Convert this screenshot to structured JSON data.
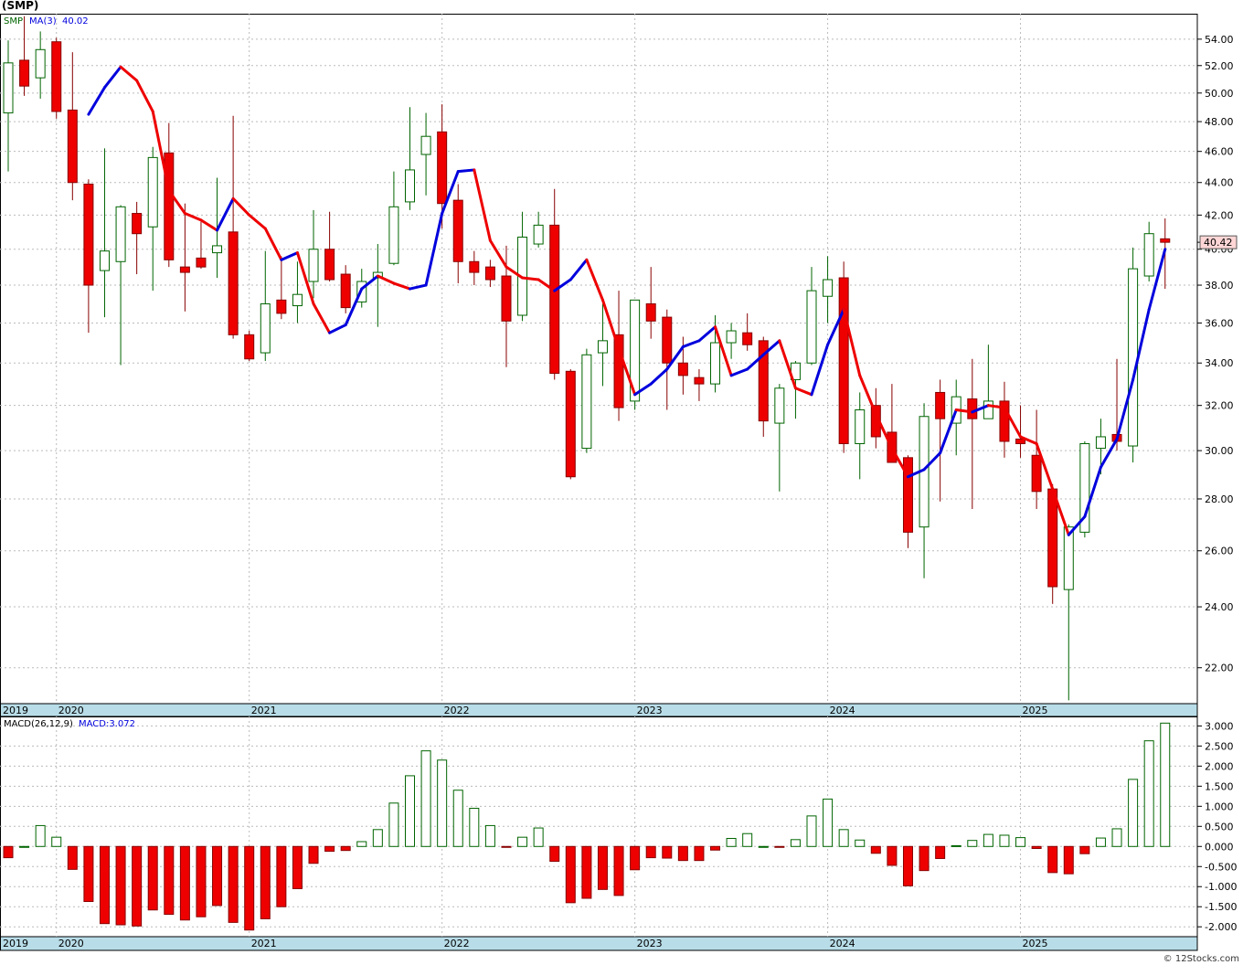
{
  "title": "(SMP)",
  "watermark": "© 12Stocks.com",
  "price_panel": {
    "symbol_label": "SMP",
    "ma_label": "MA(3)",
    "ma_value": "40.02",
    "last_price_label": "40.42",
    "y_ticks": [
      "54.00",
      "52.00",
      "50.00",
      "48.00",
      "46.00",
      "44.00",
      "42.00",
      "40.00",
      "38.00",
      "36.00",
      "34.00",
      "32.00",
      "30.00",
      "28.00",
      "26.00",
      "24.00",
      "22.00"
    ],
    "x_ticks": [
      "2019",
      "2020",
      "2021",
      "2022",
      "2023",
      "2024",
      "2025"
    ]
  },
  "macd_panel": {
    "label": "MACD(26,12,9)",
    "value_label": "MACD:3.072",
    "y_ticks": [
      "3.000",
      "2.500",
      "2.000",
      "1.500",
      "1.000",
      "0.500",
      "0.000",
      "-0.500",
      "-1.000",
      "-1.500",
      "-2.000"
    ],
    "x_ticks": [
      "2019",
      "2020",
      "2021",
      "2022",
      "2023",
      "2024",
      "2025"
    ]
  },
  "colors": {
    "up_fill": "#ffffff",
    "up_stroke": "#006400",
    "down_fill": "#ee0000",
    "down_stroke": "#880000",
    "ma_down": "#ee0000",
    "ma_up": "#0000dd",
    "axis_band": "#b8dde8",
    "grid": "#bbbbbb"
  },
  "chart_data": [
    {
      "type": "candlestick",
      "title": "(SMP)",
      "series_name": "SMP",
      "overlay": {
        "name": "MA(3)",
        "last": 40.02
      },
      "scale": "log",
      "ylim": [
        20.9,
        56.0
      ],
      "x_axis_labels": [
        "2019",
        "2020",
        "2021",
        "2022",
        "2023",
        "2024",
        "2025"
      ],
      "candles": [
        {
          "o": 48.6,
          "h": 53.9,
          "l": 44.7,
          "c": 52.2
        },
        {
          "o": 52.4,
          "h": 55.8,
          "l": 49.8,
          "c": 50.5
        },
        {
          "o": 51.1,
          "h": 54.6,
          "l": 49.6,
          "c": 53.2
        },
        {
          "o": 53.8,
          "h": 54.1,
          "l": 48.2,
          "c": 48.7
        },
        {
          "o": 48.8,
          "h": 53.0,
          "l": 42.9,
          "c": 44.0
        },
        {
          "o": 43.9,
          "h": 44.2,
          "l": 35.5,
          "c": 38.0
        },
        {
          "o": 38.8,
          "h": 46.2,
          "l": 36.3,
          "c": 39.9
        },
        {
          "o": 39.3,
          "h": 42.6,
          "l": 33.9,
          "c": 42.5
        },
        {
          "o": 42.1,
          "h": 42.8,
          "l": 38.6,
          "c": 40.9
        },
        {
          "o": 41.3,
          "h": 46.3,
          "l": 37.7,
          "c": 45.6
        },
        {
          "o": 45.9,
          "h": 47.9,
          "l": 39.0,
          "c": 39.4
        },
        {
          "o": 39.0,
          "h": 42.7,
          "l": 36.6,
          "c": 38.7
        },
        {
          "o": 39.5,
          "h": 41.6,
          "l": 38.9,
          "c": 39.0
        },
        {
          "o": 39.8,
          "h": 44.3,
          "l": 38.4,
          "c": 40.2
        },
        {
          "o": 41.0,
          "h": 48.4,
          "l": 35.2,
          "c": 35.4
        },
        {
          "o": 35.4,
          "h": 35.6,
          "l": 34.1,
          "c": 34.2
        },
        {
          "o": 34.5,
          "h": 39.9,
          "l": 34.1,
          "c": 37.0
        },
        {
          "o": 37.2,
          "h": 39.6,
          "l": 36.2,
          "c": 36.5
        },
        {
          "o": 36.9,
          "h": 39.3,
          "l": 36.0,
          "c": 37.5
        },
        {
          "o": 38.2,
          "h": 42.3,
          "l": 37.3,
          "c": 40.0
        },
        {
          "o": 40.0,
          "h": 42.2,
          "l": 38.2,
          "c": 38.3
        },
        {
          "o": 38.6,
          "h": 39.1,
          "l": 36.5,
          "c": 36.8
        },
        {
          "o": 37.1,
          "h": 38.9,
          "l": 36.8,
          "c": 38.2
        },
        {
          "o": 38.4,
          "h": 40.3,
          "l": 35.8,
          "c": 38.7
        },
        {
          "o": 39.2,
          "h": 44.7,
          "l": 39.1,
          "c": 42.5
        },
        {
          "o": 42.8,
          "h": 49.0,
          "l": 42.3,
          "c": 44.8
        },
        {
          "o": 45.8,
          "h": 48.6,
          "l": 43.2,
          "c": 47.0
        },
        {
          "o": 47.3,
          "h": 49.2,
          "l": 41.2,
          "c": 42.7
        },
        {
          "o": 42.9,
          "h": 43.9,
          "l": 38.1,
          "c": 39.3
        },
        {
          "o": 39.3,
          "h": 39.9,
          "l": 38.0,
          "c": 38.7
        },
        {
          "o": 39.0,
          "h": 39.4,
          "l": 37.9,
          "c": 38.3
        },
        {
          "o": 38.5,
          "h": 40.2,
          "l": 33.8,
          "c": 36.1
        },
        {
          "o": 36.4,
          "h": 42.2,
          "l": 36.1,
          "c": 40.7
        },
        {
          "o": 40.3,
          "h": 42.2,
          "l": 40.1,
          "c": 41.4
        },
        {
          "o": 41.4,
          "h": 43.6,
          "l": 33.2,
          "c": 33.5
        },
        {
          "o": 33.6,
          "h": 33.7,
          "l": 28.8,
          "c": 28.9
        },
        {
          "o": 30.1,
          "h": 34.7,
          "l": 29.9,
          "c": 34.4
        },
        {
          "o": 34.5,
          "h": 37.0,
          "l": 32.9,
          "c": 35.1
        },
        {
          "o": 35.4,
          "h": 37.7,
          "l": 31.3,
          "c": 31.9
        },
        {
          "o": 32.2,
          "h": 37.2,
          "l": 31.8,
          "c": 37.2
        },
        {
          "o": 37.0,
          "h": 39.0,
          "l": 35.2,
          "c": 36.1
        },
        {
          "o": 36.3,
          "h": 36.7,
          "l": 31.8,
          "c": 34.0
        },
        {
          "o": 34.0,
          "h": 35.3,
          "l": 32.5,
          "c": 33.4
        },
        {
          "o": 33.3,
          "h": 33.7,
          "l": 32.2,
          "c": 33.0
        },
        {
          "o": 33.0,
          "h": 36.4,
          "l": 32.6,
          "c": 35.0
        },
        {
          "o": 35.0,
          "h": 36.0,
          "l": 34.2,
          "c": 35.6
        },
        {
          "o": 35.5,
          "h": 36.5,
          "l": 34.6,
          "c": 34.9
        },
        {
          "o": 35.1,
          "h": 35.3,
          "l": 30.6,
          "c": 31.3
        },
        {
          "o": 31.2,
          "h": 33.0,
          "l": 28.3,
          "c": 32.8
        },
        {
          "o": 33.2,
          "h": 34.1,
          "l": 31.4,
          "c": 34.0
        },
        {
          "o": 34.0,
          "h": 39.0,
          "l": 33.9,
          "c": 37.7
        },
        {
          "o": 37.4,
          "h": 39.6,
          "l": 36.0,
          "c": 38.3
        },
        {
          "o": 38.4,
          "h": 39.3,
          "l": 29.9,
          "c": 30.3
        },
        {
          "o": 30.3,
          "h": 32.6,
          "l": 28.8,
          "c": 31.8
        },
        {
          "o": 32.0,
          "h": 32.8,
          "l": 30.1,
          "c": 30.6
        },
        {
          "o": 30.8,
          "h": 33.0,
          "l": 29.5,
          "c": 29.5
        },
        {
          "o": 29.7,
          "h": 29.8,
          "l": 26.1,
          "c": 26.7
        },
        {
          "o": 26.9,
          "h": 32.1,
          "l": 25.0,
          "c": 31.5
        },
        {
          "o": 32.6,
          "h": 33.2,
          "l": 27.9,
          "c": 31.4
        },
        {
          "o": 31.2,
          "h": 33.2,
          "l": 29.8,
          "c": 32.4
        },
        {
          "o": 32.3,
          "h": 34.2,
          "l": 27.6,
          "c": 31.4
        },
        {
          "o": 31.4,
          "h": 34.9,
          "l": 31.4,
          "c": 32.2
        },
        {
          "o": 32.2,
          "h": 33.1,
          "l": 29.7,
          "c": 30.4
        },
        {
          "o": 30.5,
          "h": 32.0,
          "l": 29.7,
          "c": 30.3
        },
        {
          "o": 29.8,
          "h": 31.8,
          "l": 27.6,
          "c": 28.3
        },
        {
          "o": 28.4,
          "h": 28.6,
          "l": 24.1,
          "c": 24.7
        },
        {
          "o": 24.6,
          "h": 27.0,
          "l": 21.0,
          "c": 26.9
        },
        {
          "o": 26.7,
          "h": 30.4,
          "l": 26.5,
          "c": 30.3
        },
        {
          "o": 30.1,
          "h": 31.4,
          "l": 29.0,
          "c": 30.6
        },
        {
          "o": 30.7,
          "h": 34.2,
          "l": 30.0,
          "c": 30.4
        },
        {
          "o": 30.2,
          "h": 40.1,
          "l": 29.5,
          "c": 38.9
        },
        {
          "o": 38.5,
          "h": 41.6,
          "l": 38.2,
          "c": 40.9
        },
        {
          "o": 40.6,
          "h": 41.8,
          "l": 37.8,
          "c": 40.4
        }
      ],
      "ma3": [
        48.5,
        50.4,
        51.9,
        50.9,
        48.7,
        43.5,
        42.1,
        41.7,
        41.1,
        43.0,
        42.0,
        41.2,
        39.4,
        39.8,
        37.0,
        35.5,
        35.9,
        37.8,
        38.5,
        38.1,
        37.8,
        38.0,
        42.1,
        44.7,
        44.8,
        40.5,
        39.0,
        38.4,
        38.3,
        37.7,
        38.3,
        39.4,
        37.2,
        34.7,
        32.5,
        33.0,
        33.7,
        34.8,
        35.1,
        35.8,
        33.4,
        33.7,
        34.4,
        35.1,
        32.8,
        32.5,
        34.9,
        36.7,
        33.4,
        31.6,
        30.1,
        28.9,
        29.2,
        29.9,
        31.8,
        31.7,
        32.0,
        31.9,
        30.6,
        30.3,
        28.4,
        26.6,
        27.3,
        29.3,
        30.5,
        33.2,
        36.7,
        40.0
      ],
      "ma3_start_index": 0
    },
    {
      "type": "bar",
      "title": "MACD(26,12,9)",
      "series_name": "MACD",
      "last": 3.072,
      "ylim": [
        -2.2,
        3.1
      ],
      "x_axis_labels": [
        "2019",
        "2020",
        "2021",
        "2022",
        "2023",
        "2024",
        "2025"
      ],
      "values": [
        -0.28,
        0.0,
        0.52,
        0.23,
        -0.57,
        -1.37,
        -1.92,
        -1.95,
        -1.98,
        -1.58,
        -1.69,
        -1.83,
        -1.75,
        -1.47,
        -1.89,
        -2.08,
        -1.8,
        -1.5,
        -1.05,
        -0.42,
        -0.12,
        -0.1,
        0.12,
        0.42,
        1.08,
        1.76,
        2.38,
        2.15,
        1.4,
        0.95,
        0.52,
        -0.02,
        0.23,
        0.46,
        -0.37,
        -1.4,
        -1.29,
        -1.07,
        -1.22,
        -0.58,
        -0.28,
        -0.29,
        -0.35,
        -0.35,
        -0.09,
        0.2,
        0.32,
        0.0,
        -0.02,
        0.17,
        0.76,
        1.18,
        0.42,
        0.16,
        -0.17,
        -0.47,
        -0.98,
        -0.6,
        -0.3,
        0.02,
        0.15,
        0.3,
        0.28,
        0.22,
        -0.05,
        -0.65,
        -0.68,
        -0.18,
        0.21,
        0.44,
        1.67,
        2.63,
        3.07
      ]
    }
  ]
}
